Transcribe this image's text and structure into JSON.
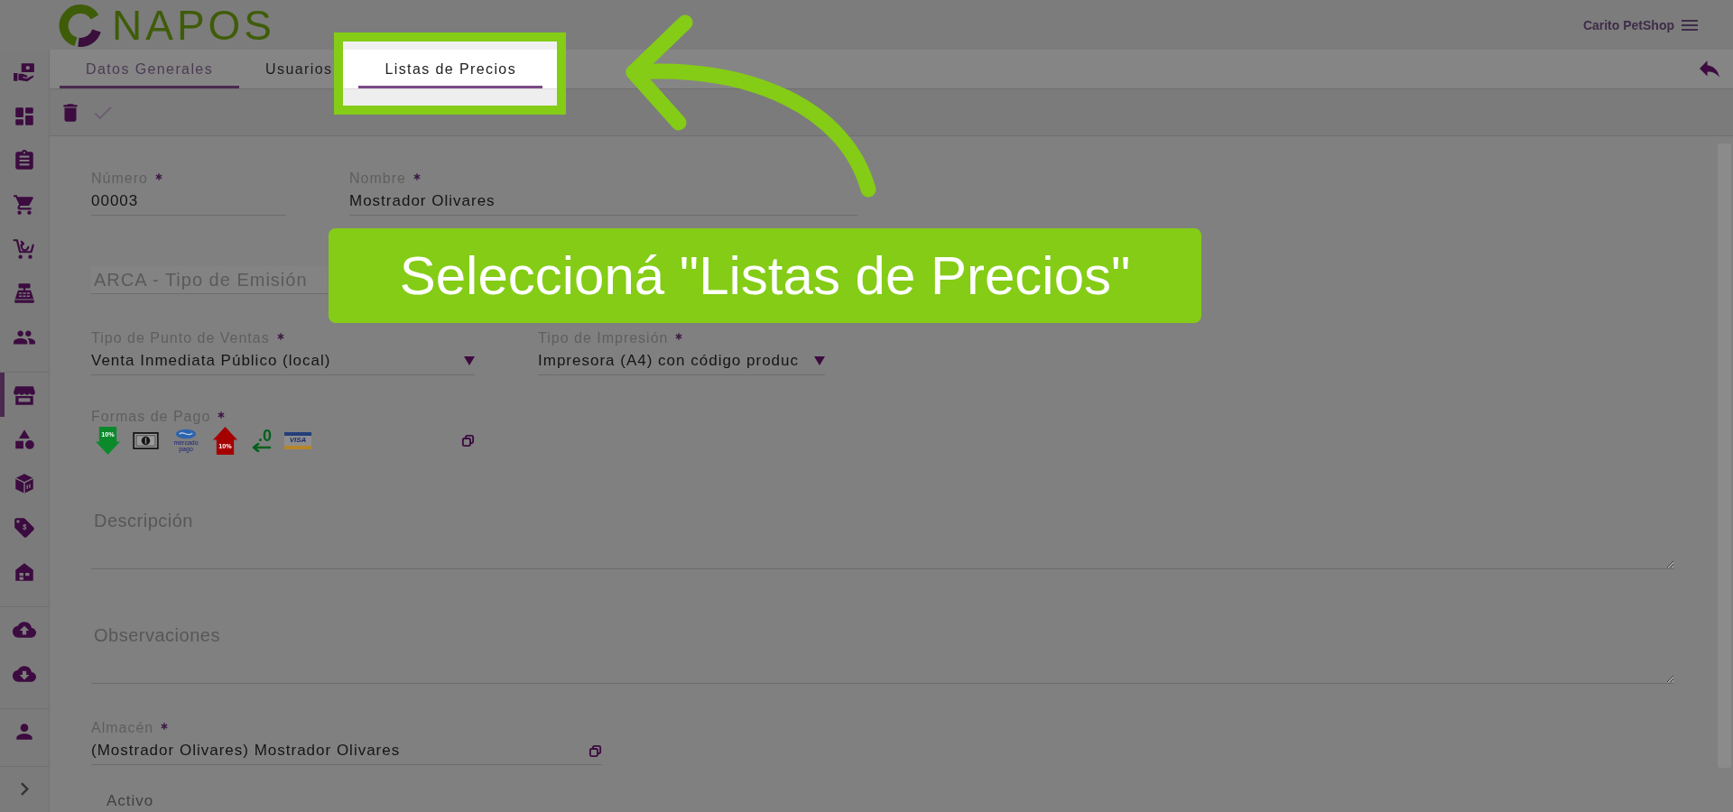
{
  "header": {
    "logo": "NAPOS",
    "account": "Carito PetShop"
  },
  "sidebar": {
    "expanded": false,
    "groups": [
      {
        "items": [
          {
            "selected": false
          },
          {
            "selected": false
          },
          {
            "selected": false
          },
          {
            "selected": false
          },
          {
            "selected": false
          },
          {
            "selected": false
          },
          {
            "selected": false
          }
        ]
      },
      {
        "items": [
          {
            "selected": true
          },
          {
            "selected": false
          },
          {
            "selected": false
          },
          {
            "selected": false
          },
          {
            "selected": false
          }
        ]
      },
      {
        "items": [
          {
            "selected": false
          },
          {
            "selected": false
          }
        ]
      },
      {
        "items": [
          {
            "selected": false
          }
        ]
      }
    ]
  },
  "tabs": [
    {
      "label": "Datos Generales",
      "selected": true,
      "highlighted": false
    },
    {
      "label": "Usuarios",
      "selected": false,
      "highlighted": false
    },
    {
      "label": "Listas de Precios",
      "selected": false,
      "highlighted": true
    }
  ],
  "toolbar": {
    "buttons": [
      {
        "disabled": false
      },
      {
        "disabled": true
      }
    ]
  },
  "form": {
    "row_1": [
      {
        "label": "Número",
        "required": true,
        "value": "00003"
      },
      {
        "label": "Nombre",
        "required": true,
        "value": "Mostrador Olivares"
      }
    ],
    "section": {
      "title": "ARCA - Tipo de Emisión"
    },
    "row_2": [
      {
        "kind": "select",
        "label": "Tipo de Punto de Ventas",
        "required": true,
        "value": "Venta Inmediata Público (local)"
      },
      {
        "kind": "select",
        "label": "Tipo de Impresión",
        "required": true,
        "value": "Impresora (A4) con código produc"
      }
    ],
    "payment_methods": {
      "label": "Formas de Pago",
      "required": true,
      "methods": [
        {
          "kind": "discount",
          "badge": "10%"
        },
        {
          "kind": "cash"
        },
        {
          "kind": "logo",
          "badge": "mercado pago"
        },
        {
          "kind": "surcharge",
          "badge": "10%"
        },
        {
          "kind": "rounding",
          "badge": ".0"
        },
        {
          "kind": "card",
          "badge": "VISA"
        }
      ]
    },
    "description": {
      "placeholder": "Descripción"
    },
    "observations": {
      "placeholder": "Observaciones"
    },
    "warehouse": {
      "kind": "lookup",
      "label": "Almacén",
      "required": true,
      "value": "(Mostrador Olivares) Mostrador Olivares"
    },
    "active": {
      "label": "Activo"
    }
  },
  "tutorial": {
    "callout": "Seleccioná \"Listas de Precios\""
  }
}
